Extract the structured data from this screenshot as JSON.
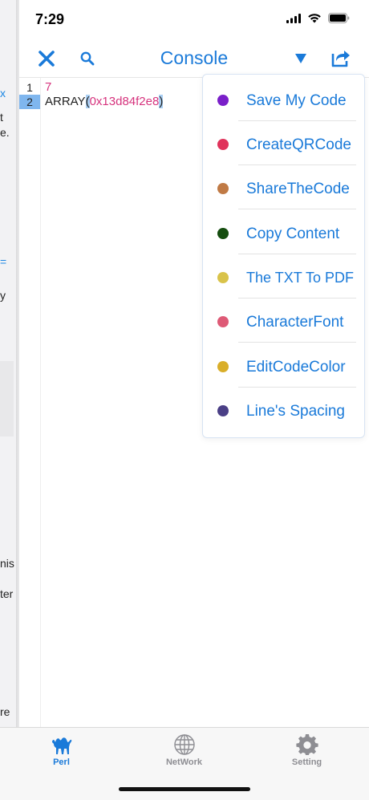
{
  "status_bar": {
    "time": "7:29"
  },
  "behind_panel": {
    "fragments": [
      "x",
      "t",
      "e.",
      "=",
      "y",
      "nis",
      "ter",
      "re"
    ]
  },
  "nav": {
    "title": "Console",
    "icons": [
      "close-icon",
      "search-icon",
      "dropdown-triangle-icon",
      "share-icon"
    ]
  },
  "editor": {
    "lines": [
      {
        "number": "1",
        "text": "7"
      },
      {
        "number": "2",
        "prefix": "ARRAY",
        "open": "(",
        "hex": "0x13d84f2e8",
        "close": ")"
      }
    ]
  },
  "menu": {
    "items": [
      {
        "label": "Save My Code",
        "color": "#7a1fc9"
      },
      {
        "label": "CreateQRCode",
        "color": "#e0335b"
      },
      {
        "label": "ShareTheCode",
        "color": "#c07a45"
      },
      {
        "label": "Copy Content",
        "color": "#154d0f"
      },
      {
        "label": "The TXT To PDF",
        "color": "#d9c34a"
      },
      {
        "label": "CharacterFont",
        "color": "#de5a76"
      },
      {
        "label": "EditCodeColor",
        "color": "#d9ae2a"
      },
      {
        "label": "Line's Spacing",
        "color": "#4a3f86"
      }
    ]
  },
  "tabbar": {
    "tabs": [
      {
        "label": "Perl",
        "icon": "camel-icon",
        "active": true
      },
      {
        "label": "NetWork",
        "icon": "globe-icon",
        "active": false
      },
      {
        "label": "Setting",
        "icon": "gear-icon",
        "active": false
      }
    ],
    "colors": {
      "active": "#1a7ad9",
      "inactive": "#8e8e93"
    }
  }
}
